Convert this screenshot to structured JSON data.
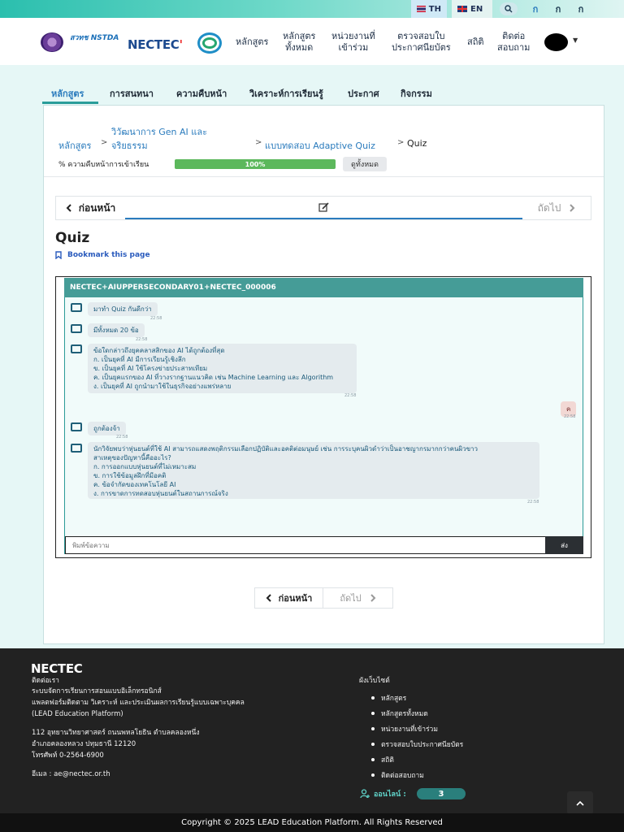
{
  "topbar": {
    "lang_th": "TH",
    "lang_en": "EN",
    "font_buttons": [
      "ก",
      "ก",
      "ก"
    ]
  },
  "header": {
    "logo_nstda": "สวทช NSTDA",
    "logo_nectec": "NECTEC",
    "nav": [
      {
        "label": "หลักสูตร"
      },
      {
        "label": "หลักสูตร\nทั้งหมด"
      },
      {
        "label": "หน่วยงานที่\nเข้าร่วม"
      },
      {
        "label": "ตรวจสอบใบ\nประกาศนียบัตร"
      },
      {
        "label": "สถิติ"
      },
      {
        "label": "ติดต่อ\nสอบถาม"
      }
    ]
  },
  "tabs": [
    {
      "label": "หลักสูตร",
      "active": true
    },
    {
      "label": "การสนทนา"
    },
    {
      "label": "ความคืบหน้า"
    },
    {
      "label": "วิเคราะห์การเรียนรู้"
    },
    {
      "label": "ประกาศ"
    },
    {
      "label": "กิจกรรม"
    }
  ],
  "breadcrumb": {
    "home": "หลักสูตร",
    "course_line1": "วิวัฒนาการ Gen AI และ",
    "course_line2": "จริยธรรม",
    "section": "แบบทดสอบ Adaptive Quiz",
    "current": "Quiz"
  },
  "progress": {
    "label": "% ความคืบหน้าการเข้าเรียน",
    "percent": 100,
    "text": "100%",
    "view_all": "ดูทั้งหมด"
  },
  "sequence": {
    "prev": "ก่อนหน้า",
    "next": "ถัดไป"
  },
  "unit": {
    "title": "Quiz",
    "bookmark": "Bookmark this page"
  },
  "chat": {
    "header": "NECTEC+AIUPPERSECONDARY01+NECTEC_000006",
    "messages": [
      {
        "from": "bot",
        "lines": [
          "มาทำ Quiz กันดีกว่า"
        ],
        "time": "22:58"
      },
      {
        "from": "bot",
        "lines": [
          "มีทั้งหมด 20 ข้อ"
        ],
        "time": "22:58"
      },
      {
        "from": "bot",
        "lines": [
          "ข้อใดกล่าวถึงยุคคลาสสิกของ AI ได้ถูกต้องที่สุด",
          "ก. เป็นยุคที่ AI มีการเรียนรู้เชิงลึก",
          "ข. เป็นยุคที่ AI ใช้โครงข่ายประสาทเทียม",
          "ค. เป็นยุคแรกของ AI ที่วางรากฐานแนวคิด เช่น Machine Learning และ Algorithm",
          "ง. เป็นยุคที่ AI ถูกนำมาใช้ในธุรกิจอย่างแพร่หลาย"
        ],
        "time": "22:58"
      },
      {
        "from": "user",
        "lines": [
          "ค"
        ],
        "time": "22:58"
      },
      {
        "from": "bot",
        "lines": [
          "ถูกต้องจ้า"
        ],
        "time": "22:58"
      },
      {
        "from": "bot",
        "lines": [
          "นักวิจัยพบว่าหุ่นยนต์ที่ใช้ AI สามารถแสดงพฤติกรรมเลือกปฏิบัติและอคติต่อมนุษย์ เช่น การระบุคนผิวดำว่าเป็นอาชญากรมากกว่าคนผิวขาว",
          "สาเหตุของปัญหานี้คืออะไร?",
          "ก. การออกแบบหุ่นยนต์ที่ไม่เหมาะสม",
          "ข. การใช้ข้อมูลฝึกที่มีอคติ",
          "ค. ข้อจำกัดของเทคโนโลยี AI",
          "ง. การขาดการทดสอบหุ่นยนต์ในสถานการณ์จริง"
        ],
        "time": "22:58"
      }
    ],
    "input_placeholder": "พิมพ์ข้อความ",
    "send": "ส่ง"
  },
  "bottom_nav": {
    "prev": "ก่อนหน้า",
    "next": "ถัดไป"
  },
  "footer": {
    "logo": "NECTEC",
    "contact_title": "ติดต่อเรา",
    "about": [
      "ระบบจัดการเรียนการสอนแบบอิเล็กทรอนิกส์",
      "แพลตฟอร์มติดตาม วิเคราะห์ และประเมินผลการเรียนรู้แบบเฉพาะบุคคล",
      "(LEAD Education Platform)"
    ],
    "address": [
      "112 อุทยานวิทยาศาสตร์ ถนนพหลโยธิน ตำบลคลองหนึ่ง",
      "อำเภอคลองหลวง ปทุมธานี 12120",
      "โทรศัพท์ 0-2564-6900"
    ],
    "email": "อีเมล : ae@nectec.or.th",
    "sitemap_title": "ผังเว็บไซต์",
    "sitemap": [
      "หลักสูตร",
      "หลักสูตรทั้งหมด",
      "หน่วยงานที่เข้าร่วม",
      "ตรวจสอบใบประกาศนียบัตร",
      "สถิติ",
      "ติดต่อสอบถาม"
    ],
    "online_label": "ออนไลน์ :",
    "online_count": "3",
    "copyright": "Copyright © 2025 LEAD Education Platform. All Rights Reserved"
  }
}
